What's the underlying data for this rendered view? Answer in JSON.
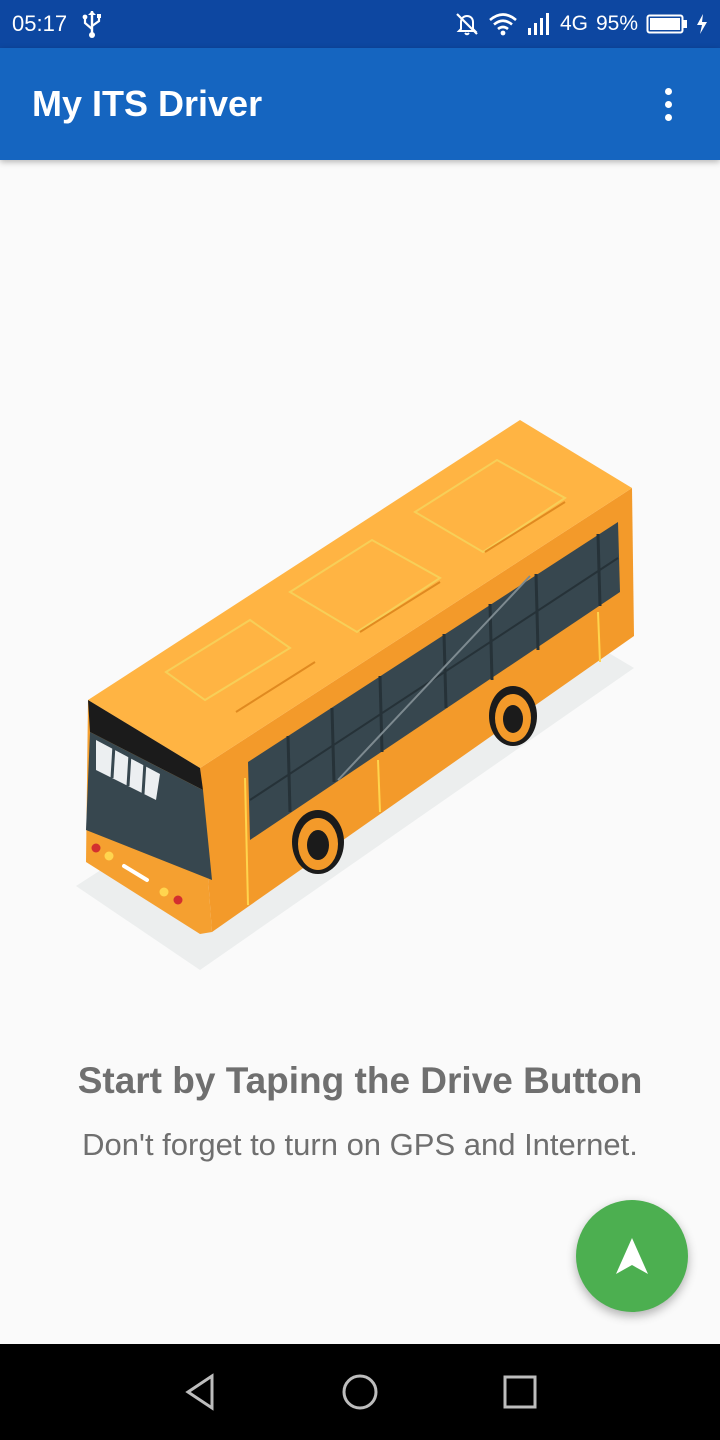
{
  "status_bar": {
    "time": "05:17",
    "network": "4G",
    "battery": "95%",
    "icons": [
      "usb-icon",
      "notifications-off-icon",
      "wifi-icon",
      "signal-icon",
      "battery-icon",
      "charging-icon"
    ]
  },
  "app_bar": {
    "title": "My ITS Driver",
    "menu_icon": "more-vert-icon"
  },
  "empty_state": {
    "illustration": "bus-illustration",
    "title": "Start by Taping the Drive Button",
    "subtitle": "Don't forget to turn on GPS and Internet."
  },
  "fab": {
    "icon": "navigation-arrow-icon",
    "color": "#4caf50"
  },
  "nav_bar": {
    "buttons": [
      "back-icon",
      "home-icon",
      "recents-icon"
    ]
  },
  "colors": {
    "status_bar": "#0d47a1",
    "app_bar": "#1565c0",
    "bus_body": "#f7a530",
    "bus_roof": "#ffb443",
    "windows": "#37474f"
  }
}
